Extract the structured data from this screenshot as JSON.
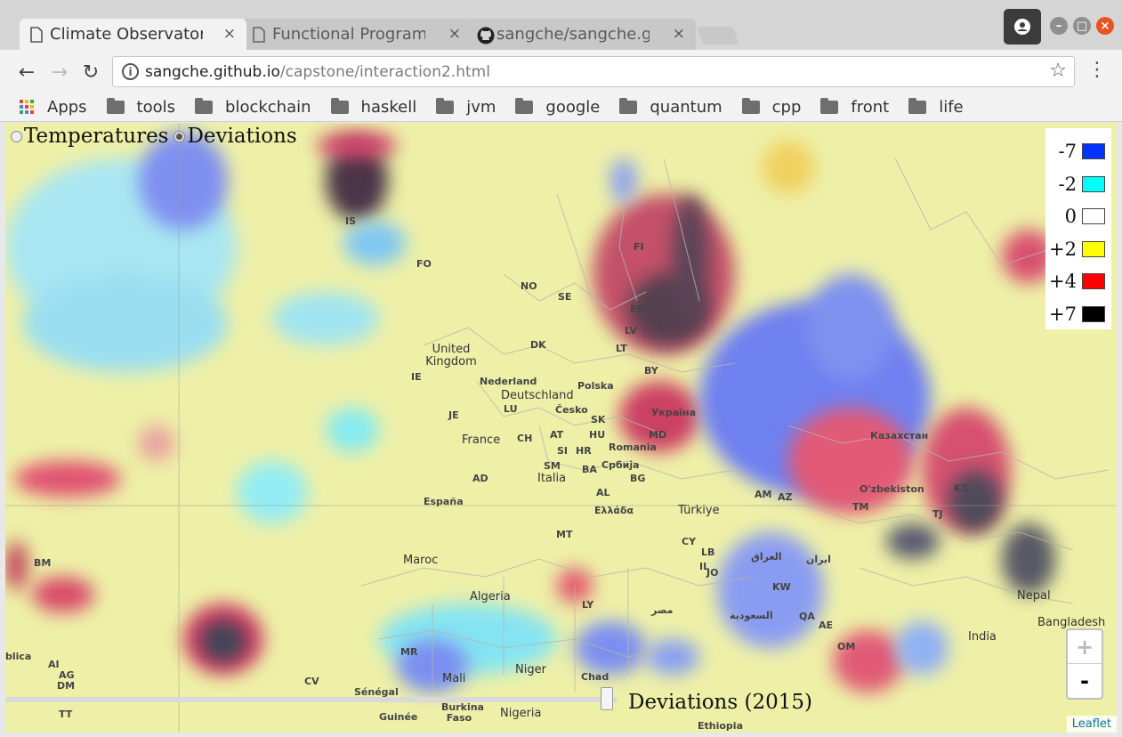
{
  "tabs": [
    {
      "title": "Climate Observatory",
      "close": "×",
      "icon": "page-icon",
      "active": true
    },
    {
      "title": "Functional Programming",
      "close": "×",
      "icon": "page-icon",
      "active": false
    },
    {
      "title": "sangche/sangche.github.io",
      "close": "×",
      "icon": "github-icon",
      "active": false
    }
  ],
  "toolbar": {
    "back": "←",
    "forward": "→",
    "reload": "↻",
    "url_host": "sangche.github.io",
    "url_path": "/capstone/interaction2.html",
    "star": "☆",
    "menu": "⋮"
  },
  "bookmarks": {
    "apps_label": "Apps",
    "folders": [
      "tools",
      "blockchain",
      "haskell",
      "jvm",
      "google",
      "quantum",
      "cpp",
      "front",
      "life"
    ]
  },
  "map": {
    "layers": [
      "Temperatures",
      "Deviations"
    ],
    "selected_layer": "Deviations",
    "legend": [
      {
        "label": "-7",
        "color": "#0033ff"
      },
      {
        "label": "-2",
        "color": "#00ffff"
      },
      {
        "label": "0",
        "color": "#ffffff"
      },
      {
        "label": "+2",
        "color": "#ffff00"
      },
      {
        "label": "+4",
        "color": "#ff0000"
      },
      {
        "label": "+7",
        "color": "#000000"
      }
    ],
    "zoom_in": "+",
    "zoom_out": "-",
    "year_label": "Deviations (2015)",
    "year_fraction": 0.98,
    "attribution": "Leaflet",
    "place_labels": [
      "IS",
      "FO",
      "FI",
      "NO",
      "SE",
      "EE",
      "LV",
      "LT",
      "DK",
      "United Kingdom",
      "IE",
      "BY",
      "Nederland",
      "Deutschland",
      "Polska",
      "LU",
      "Česko",
      "SK",
      "Україна",
      "JE",
      "France",
      "CH",
      "AT",
      "HU",
      "MD",
      "Romania",
      "SI",
      "HR",
      "Србија",
      "SM",
      "Italia",
      "BA",
      "BG",
      "AD",
      "España",
      "AL",
      "Ελλάδα",
      "Türkiye",
      "AM",
      "AZ",
      "Казахстан",
      "O'zbekiston",
      "KG",
      "TJ",
      "TM",
      "MT",
      "CY",
      "LB",
      "IL",
      "JO",
      "العراق",
      "ایران",
      "KW",
      "QA",
      "AE",
      "OM",
      "Maroc",
      "Algeria",
      "LY",
      "مصر",
      "السعودية",
      "Nepal",
      "Bangladesh",
      "India",
      "MR",
      "Mali",
      "Niger",
      "Chad",
      "Sénégal",
      "Burkina Faso",
      "Guinée",
      "Nigeria",
      "Ethiopia",
      "CV",
      "BM",
      "AI",
      "AG",
      "DM",
      "TT",
      "blica"
    ]
  }
}
